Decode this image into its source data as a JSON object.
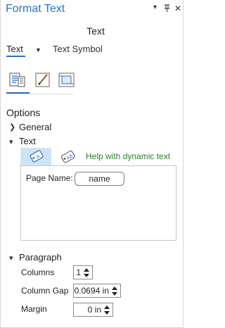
{
  "pane": {
    "title": "Format Text",
    "subtitle": "Text",
    "controls": [
      "dropdown-icon",
      "pin-icon",
      "close-icon"
    ]
  },
  "tabs": [
    {
      "label": "Text",
      "selected": true
    },
    {
      "label": "Text Symbol",
      "selected": false
    }
  ],
  "tool_icons": [
    "text-properties-icon",
    "symbol-brush-icon",
    "position-frame-icon"
  ],
  "options": {
    "label": "Options",
    "groups": {
      "general": {
        "label": "General",
        "expanded": false
      },
      "text": {
        "label": "Text",
        "expanded": true
      },
      "paragraph": {
        "label": "Paragraph",
        "expanded": true
      }
    }
  },
  "dynamic": {
    "help_link": "Help with dynamic text",
    "icons": [
      "insert-dynamic-text-icon",
      "dynamic-text-tag-icon"
    ],
    "link_color": "#2a7d2a"
  },
  "text_editor": {
    "static_label": "Page Name:",
    "chip": "name"
  },
  "paragraph": {
    "columns_label": "Columns",
    "columns_value": "1",
    "gap_label": "Column Gap",
    "gap_value": "0.0694 in",
    "margin_label": "Margin",
    "margin_value": "0 in"
  },
  "colors": {
    "accent": "#2b6fc2",
    "selected_icon_bg": "#cfe3f7"
  }
}
